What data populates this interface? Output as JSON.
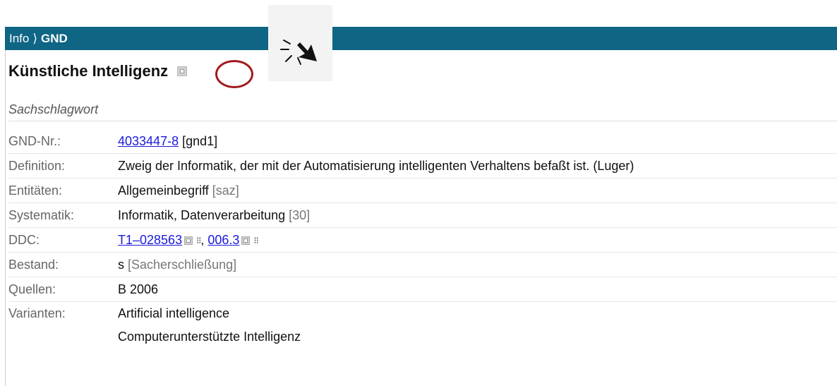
{
  "header": {
    "crumb_root": "Info",
    "crumb_sep": "⟩",
    "crumb_current": "GND"
  },
  "title": "Künstliche Intelligenz",
  "subtitle": "Sachschlagwort",
  "fields": {
    "gnd_nr": {
      "label": "GND-Nr.:",
      "link": "4033447-8",
      "suffix": "[gnd1]"
    },
    "definition": {
      "label": "Definition:",
      "value": "Zweig der Informatik, der mit der Automatisierung intelligenten Verhaltens befaßt ist. (Luger)"
    },
    "entitaeten": {
      "label": "Entitäten:",
      "value": "Allgemeinbegriff",
      "code": "[saz]"
    },
    "systematik": {
      "label": "Systematik:",
      "value": "Informatik, Datenverarbeitung",
      "code": "[30]"
    },
    "ddc": {
      "label": "DDC:",
      "link1": "T1–028563",
      "sep": ",",
      "link2": "006.3",
      "tree_glyph": "⁝⁝"
    },
    "bestand": {
      "label": "Bestand:",
      "value": "s",
      "code": "[Sacherschließung]"
    },
    "quellen": {
      "label": "Quellen:",
      "value": "B 2006"
    },
    "varianten": {
      "label": "Varianten:",
      "values": [
        "Artificial intelligence",
        "Computerunterstützte Intelligenz"
      ]
    }
  },
  "icons": {
    "title_icon": "external-link-icon",
    "cursor": "click-cursor-icon",
    "tree": "hierarchy-icon"
  },
  "colors": {
    "header_bg": "#0f6584",
    "link": "#1a1adb",
    "highlight_circle": "#a3191c"
  }
}
